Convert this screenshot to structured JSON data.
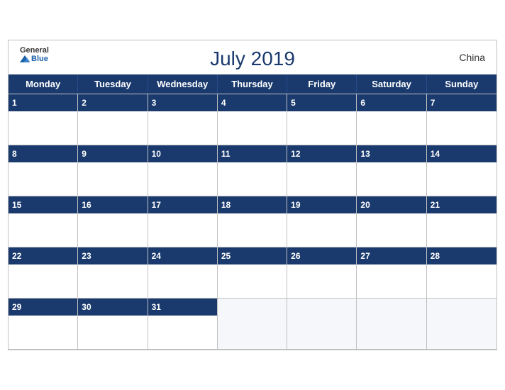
{
  "header": {
    "title": "July 2019",
    "country": "China",
    "logo": {
      "general": "General",
      "blue": "Blue"
    }
  },
  "dayHeaders": [
    "Monday",
    "Tuesday",
    "Wednesday",
    "Thursday",
    "Friday",
    "Saturday",
    "Sunday"
  ],
  "weeks": [
    [
      1,
      2,
      3,
      4,
      5,
      6,
      7
    ],
    [
      8,
      9,
      10,
      11,
      12,
      13,
      14
    ],
    [
      15,
      16,
      17,
      18,
      19,
      20,
      21
    ],
    [
      22,
      23,
      24,
      25,
      26,
      27,
      28
    ],
    [
      29,
      30,
      31,
      null,
      null,
      null,
      null
    ]
  ]
}
